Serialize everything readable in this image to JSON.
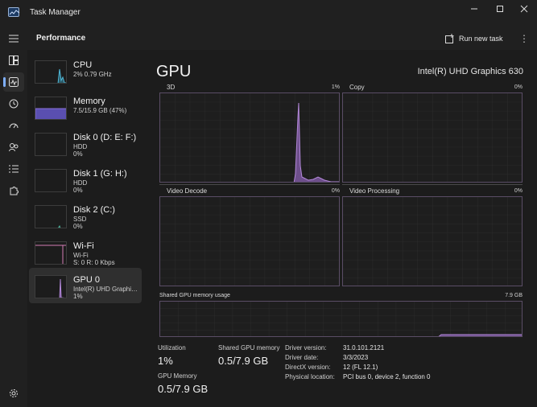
{
  "window": {
    "title": "Task Manager"
  },
  "header": {
    "title": "Performance",
    "run_new_task": "Run new task"
  },
  "devices": [
    {
      "name": "CPU",
      "line1": "2% 0.79 GHz",
      "line2": ""
    },
    {
      "name": "Memory",
      "line1": "7.5/15.9 GB (47%)",
      "line2": ""
    },
    {
      "name": "Disk 0 (D: E: F:)",
      "line1": "HDD",
      "line2": "0%"
    },
    {
      "name": "Disk 1 (G: H:)",
      "line1": "HDD",
      "line2": "0%"
    },
    {
      "name": "Disk 2 (C:)",
      "line1": "SSD",
      "line2": "0%"
    },
    {
      "name": "Wi-Fi",
      "line1": "Wi-Fi",
      "line2": "S: 0 R: 0 Kbps"
    },
    {
      "name": "GPU 0",
      "line1": "Intel(R) UHD Graphics 630",
      "line2": "1%"
    }
  ],
  "gpu": {
    "title": "GPU",
    "model": "Intel(R) UHD Graphics 630",
    "engines": [
      {
        "label": "3D",
        "pct": "1%"
      },
      {
        "label": "Copy",
        "pct": "0%"
      },
      {
        "label": "Video Decode",
        "pct": "0%"
      },
      {
        "label": "Video Processing",
        "pct": "0%"
      }
    ],
    "shared_memory_graph": {
      "label": "Shared GPU memory usage",
      "max": "7.9 GB"
    },
    "stats": {
      "utilization_label": "Utilization",
      "utilization_value": "1%",
      "shared_label": "Shared GPU memory",
      "shared_value": "0.5/7.9 GB",
      "gpu_memory_label": "GPU Memory",
      "gpu_memory_value": "0.5/7.9 GB"
    },
    "info": [
      {
        "key": "Driver version:",
        "value": "31.0.101.2121"
      },
      {
        "key": "Driver date:",
        "value": "3/3/2023"
      },
      {
        "key": "DirectX version:",
        "value": "12 (FL 12.1)"
      },
      {
        "key": "Physical location:",
        "value": "PCI bus 0, device 2, function 0"
      }
    ]
  },
  "colors": {
    "accent": "#b388d9",
    "cpu": "#4fb8d8",
    "memory": "#8a6fd8",
    "wifi": "#d37cb4"
  }
}
